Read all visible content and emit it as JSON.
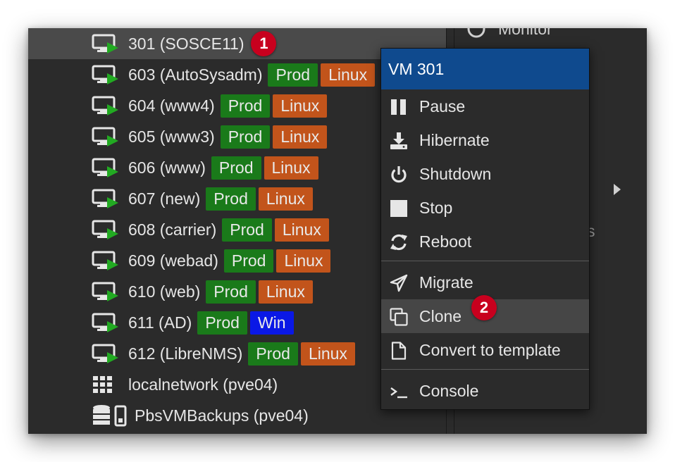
{
  "tree": {
    "rows": [
      {
        "label": "301 (SOSCE11)",
        "tags": [],
        "marker": "1"
      },
      {
        "label": "603 (AutoSysadm)",
        "tags": [
          {
            "text": "Prod",
            "kind": "prod"
          },
          {
            "text": "Linux",
            "kind": "linux"
          }
        ]
      },
      {
        "label": "604 (www4)",
        "tags": [
          {
            "text": "Prod",
            "kind": "prod"
          },
          {
            "text": "Linux",
            "kind": "linux"
          }
        ]
      },
      {
        "label": "605 (www3)",
        "tags": [
          {
            "text": "Prod",
            "kind": "prod"
          },
          {
            "text": "Linux",
            "kind": "linux"
          }
        ]
      },
      {
        "label": "606 (www)",
        "tags": [
          {
            "text": "Prod",
            "kind": "prod"
          },
          {
            "text": "Linux",
            "kind": "linux"
          }
        ]
      },
      {
        "label": "607 (new)",
        "tags": [
          {
            "text": "Prod",
            "kind": "prod"
          },
          {
            "text": "Linux",
            "kind": "linux"
          }
        ]
      },
      {
        "label": "608 (carrier)",
        "tags": [
          {
            "text": "Prod",
            "kind": "prod"
          },
          {
            "text": "Linux",
            "kind": "linux"
          }
        ]
      },
      {
        "label": "609 (webad)",
        "tags": [
          {
            "text": "Prod",
            "kind": "prod"
          },
          {
            "text": "Linux",
            "kind": "linux"
          }
        ]
      },
      {
        "label": "610 (web)",
        "tags": [
          {
            "text": "Prod",
            "kind": "prod"
          },
          {
            "text": "Linux",
            "kind": "linux"
          }
        ]
      },
      {
        "label": "611 (AD)",
        "tags": [
          {
            "text": "Prod",
            "kind": "prod"
          },
          {
            "text": "Win",
            "kind": "win"
          }
        ]
      },
      {
        "label": "612 (LibreNMS)",
        "tags": [
          {
            "text": "Prod",
            "kind": "prod"
          },
          {
            "text": "Linux",
            "kind": "linux"
          }
        ]
      },
      {
        "label": "localnetwork (pve04)",
        "tags": []
      },
      {
        "label": "PbsVMBackups (pve04)",
        "tags": []
      }
    ]
  },
  "right_panel": {
    "partial_top_text": "Monitor",
    "partial_mid_text": "s"
  },
  "context_menu": {
    "title": "VM 301",
    "items": {
      "pause": "Pause",
      "hibernate": "Hibernate",
      "shutdown": "Shutdown",
      "stop": "Stop",
      "reboot": "Reboot",
      "migrate": "Migrate",
      "clone": "Clone",
      "convert": "Convert to template",
      "console": "Console"
    },
    "clone_marker": "2"
  },
  "colors": {
    "prod_tag": "#1a7a1a",
    "linux_tag": "#c2541b",
    "win_tag": "#0a18e6",
    "menu_header": "#0f4a8e",
    "marker": "#c8001e",
    "running_arrow": "#22aa22"
  },
  "icons": {
    "vm": "vm-running-icon",
    "network": "network-grid-icon",
    "storage": "storage-icon"
  }
}
